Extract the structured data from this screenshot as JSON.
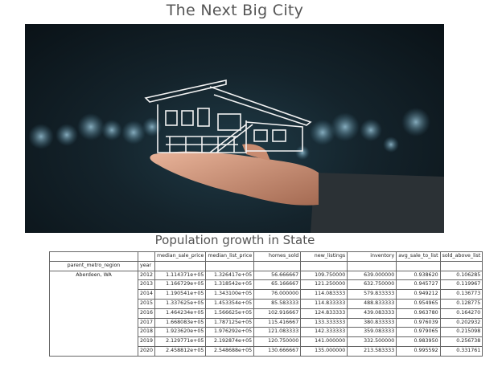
{
  "page": {
    "title": "The Next Big City",
    "section_title": "Population growth in State"
  },
  "hero_image": {
    "icon": "house-on-hand-image",
    "bokeh_color": "#7fb6cf"
  },
  "table": {
    "columns": [
      "median_sale_price",
      "median_list_price",
      "homes_sold",
      "new_listings",
      "inventory",
      "avg_sale_to_list",
      "sold_above_list"
    ],
    "index_header": "parent_metro_region",
    "year_header": "year",
    "group_label": "Aberdeen, WA",
    "rows": [
      {
        "year": "2012",
        "values": [
          "1.114371e+05",
          "1.326417e+05",
          "56.666667",
          "109.750000",
          "639.000000",
          "0.938620",
          "0.106285"
        ]
      },
      {
        "year": "2013",
        "values": [
          "1.166729e+05",
          "1.318542e+05",
          "65.166667",
          "121.250000",
          "632.750000",
          "0.945727",
          "0.119967"
        ]
      },
      {
        "year": "2014",
        "values": [
          "1.190541e+05",
          "1.343100e+05",
          "76.000000",
          "114.083333",
          "579.833333",
          "0.949212",
          "0.136773"
        ]
      },
      {
        "year": "2015",
        "values": [
          "1.337625e+05",
          "1.453354e+05",
          "85.583333",
          "114.833333",
          "488.833333",
          "0.954965",
          "0.128775"
        ]
      },
      {
        "year": "2016",
        "values": [
          "1.464234e+05",
          "1.566625e+05",
          "102.916667",
          "124.833333",
          "439.083333",
          "0.963780",
          "0.164270"
        ]
      },
      {
        "year": "2017",
        "values": [
          "1.668083e+05",
          "1.787125e+05",
          "115.416667",
          "133.333333",
          "380.833333",
          "0.976039",
          "0.202932"
        ]
      },
      {
        "year": "2018",
        "values": [
          "1.923620e+05",
          "1.976292e+05",
          "121.083333",
          "142.333333",
          "359.083333",
          "0.979065",
          "0.215098"
        ]
      },
      {
        "year": "2019",
        "values": [
          "2.129771e+05",
          "2.192874e+05",
          "120.750000",
          "141.000000",
          "332.500000",
          "0.983950",
          "0.256738"
        ]
      },
      {
        "year": "2020",
        "values": [
          "2.458812e+05",
          "2.548688e+05",
          "130.666667",
          "135.000000",
          "213.583333",
          "0.995592",
          "0.331761"
        ]
      }
    ]
  }
}
